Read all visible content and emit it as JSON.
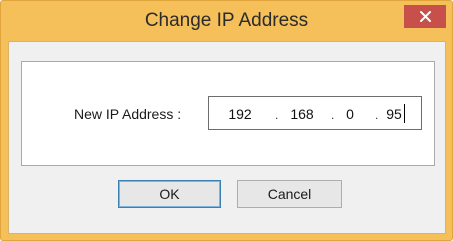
{
  "dialog": {
    "title": "Change IP Address",
    "close_icon": "close-icon"
  },
  "form": {
    "ip_label": "New IP Address :",
    "ip_octets": [
      "192",
      "168",
      "0",
      "95"
    ],
    "separator": "."
  },
  "buttons": {
    "ok_label": "OK",
    "cancel_label": "Cancel"
  },
  "colors": {
    "window_frame": "#f5c05a",
    "close_button": "#c7504a",
    "client_background": "#f0f0f0",
    "default_button_border": "#3c7fb1"
  }
}
